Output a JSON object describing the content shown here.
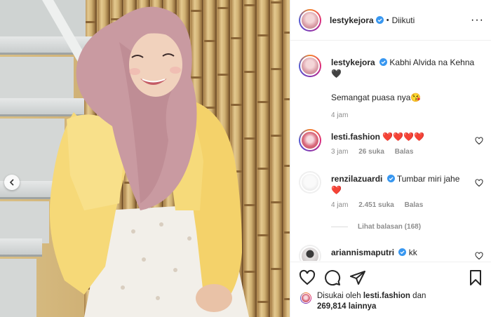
{
  "post": {
    "username": "lestykejora",
    "follow_status": "Diikuti",
    "caption_line1": "Kabhi Alvida na Kehna",
    "caption_heart": "🖤",
    "caption_line2": "Semangat puasa nya😘",
    "caption_time": "4 jam"
  },
  "comments": [
    {
      "username": "lesti.fashion",
      "text": "❤️❤️❤️❤️",
      "time": "3 jam",
      "likes": "26 suka",
      "reply": "Balas",
      "verified": false
    },
    {
      "username": "renzilazuardi",
      "text": "Tumbar miri jahe",
      "text2": "❤️",
      "time": "4 jam",
      "likes": "2.451 suka",
      "reply": "Balas",
      "verified": true
    },
    {
      "username": "ariannismaputri",
      "text": "kk",
      "verified": true
    }
  ],
  "view_replies": "Lihat balasan (168)",
  "likes_summary": {
    "prefix": "Disukai oleh",
    "user": "lesti.fashion",
    "conj": "dan",
    "count": "269,814",
    "suffix": "lainnya"
  },
  "icons": [
    "verified-badge-icon",
    "more-icon",
    "heart-icon",
    "comment-icon",
    "share-icon",
    "bookmark-icon",
    "chevron-left-icon"
  ],
  "colors": {
    "verified": "#3897f0",
    "heart": "#ed4956",
    "muted": "#8e8e8e"
  }
}
